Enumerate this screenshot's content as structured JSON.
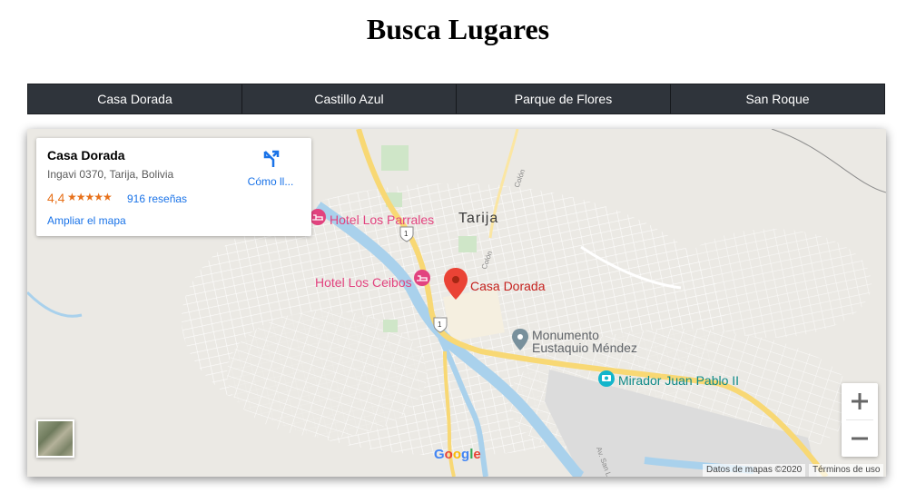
{
  "page": {
    "title": "Busca Lugares"
  },
  "tabs": [
    {
      "label": "Casa Dorada"
    },
    {
      "label": "Castillo Azul"
    },
    {
      "label": "Parque de Flores"
    },
    {
      "label": "San Roque"
    }
  ],
  "info_card": {
    "name": "Casa Dorada",
    "address": "Ingavi 0370, Tarija, Bolivia",
    "rating": "4,4",
    "stars": "★★★★★",
    "reviews": "916 reseñas",
    "enlarge": "Ampliar el mapa",
    "directions": "Cómo ll..."
  },
  "map": {
    "city": "Tarija",
    "places": {
      "hotel_parrales": "Hotel Los Parrales",
      "hotel_ceibos": "Hotel Los Ceibos",
      "casa_dorada": "Casa Dorada",
      "monumento_line1": "Monumento",
      "monumento_line2": "Eustaquio Méndez",
      "mirador": "Mirador Juan Pablo II"
    },
    "streets": {
      "colon1": "Colón",
      "colon2": "Colón",
      "av_san": "Av. San L"
    },
    "route_shield": "1",
    "zoom_in": "+",
    "zoom_out": "−",
    "google": [
      "G",
      "o",
      "o",
      "g",
      "l",
      "e"
    ],
    "attribution": "Datos de mapas ©2020",
    "terms": "Términos de uso"
  },
  "colors": {
    "accent_link": "#1a73e8",
    "rating": "#e7711b",
    "tab_bg": "#2f343b",
    "pin": "#ea4335"
  }
}
